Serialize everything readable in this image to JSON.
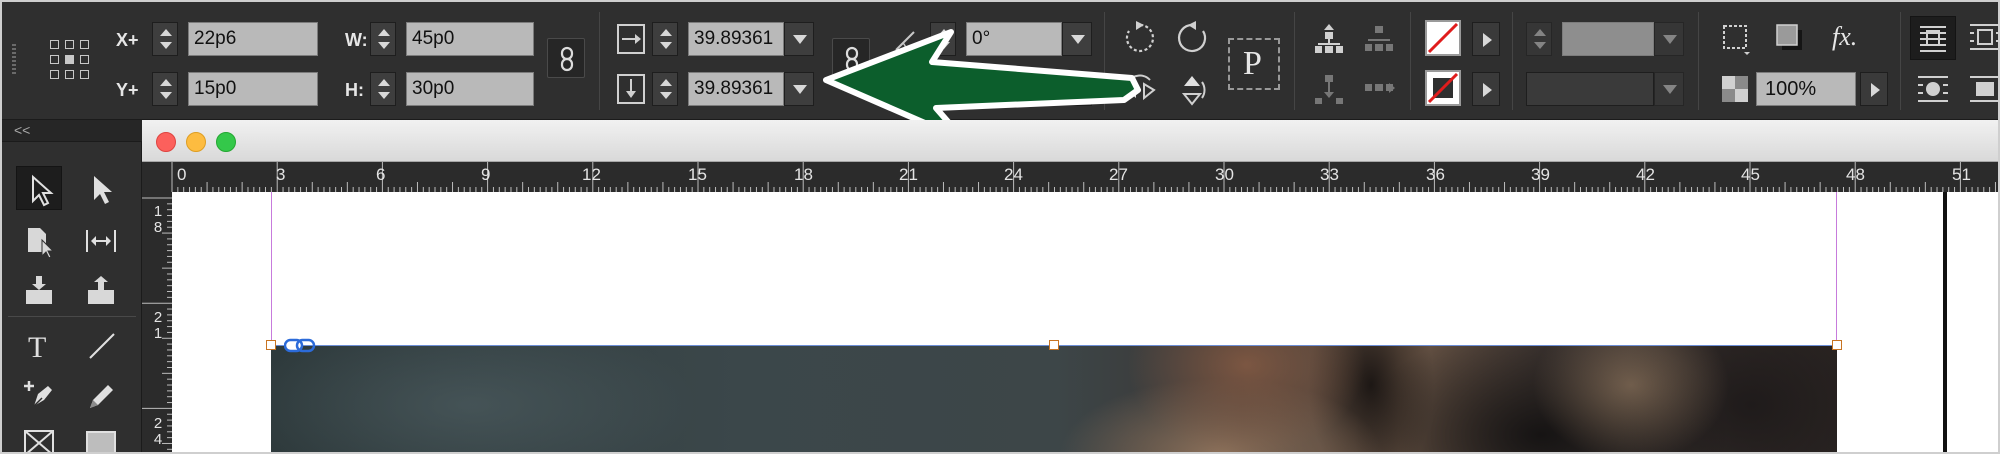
{
  "window": {
    "title": "",
    "traffic_lights": {
      "close": "#fc605c",
      "minimize": "#fdbc40",
      "zoom": "#34c84a"
    }
  },
  "control_panel": {
    "x_label": "X+",
    "x_value": "22p6",
    "y_label": "Y+",
    "y_value": "15p0",
    "w_label": "W:",
    "w_value": "45p0",
    "h_label": "H:",
    "h_value": "30p0",
    "scale_x_value": "39.89361",
    "scale_y_value": "39.89361",
    "rotate_value": "0°",
    "opacity_value": "100%",
    "paragraph_icon_text": "P",
    "fx_text": "fx."
  },
  "annotation": {
    "arrow_color": "#0c5e2c",
    "arrow_outline": "#ffffff"
  },
  "tools_panel": {
    "collapse_label": "<<"
  },
  "ruler": {
    "horizontal_labels": [
      "0",
      "3",
      "6",
      "9",
      "12",
      "15",
      "18",
      "21",
      "24",
      "27",
      "30",
      "33",
      "36",
      "39",
      "42",
      "45",
      "48",
      "51"
    ],
    "vertical_labels": [
      [
        "1",
        "8"
      ],
      [
        "2",
        "1"
      ],
      [
        "2",
        "4"
      ]
    ]
  },
  "colors": {
    "panel_bg": "#2f2f2f",
    "field_bg": "#b9b9b9",
    "guide": "#c77bdc",
    "handle": "#c87422"
  },
  "icons": [
    "reference-point-icon",
    "chain-link-icon",
    "scale-x-icon",
    "scale-y-icon",
    "rotate-icon",
    "shear-icon",
    "rotate-cw-icon",
    "rotate-ccw-icon",
    "flip-horizontal-icon",
    "flip-vertical-icon",
    "paragraph-icon",
    "fill-swatch-icon",
    "stroke-swatch-icon",
    "frame-fitting-icon",
    "drop-shadow-icon",
    "effects-icon",
    "text-wrap-icon",
    "selection-tool-icon",
    "direct-selection-tool-icon",
    "page-tool-icon",
    "gap-tool-icon",
    "content-collector-icon",
    "content-placer-icon",
    "type-tool-icon",
    "line-tool-icon",
    "pen-tool-icon",
    "pencil-tool-icon",
    "rectangle-frame-tool-icon",
    "rectangle-tool-icon"
  ]
}
